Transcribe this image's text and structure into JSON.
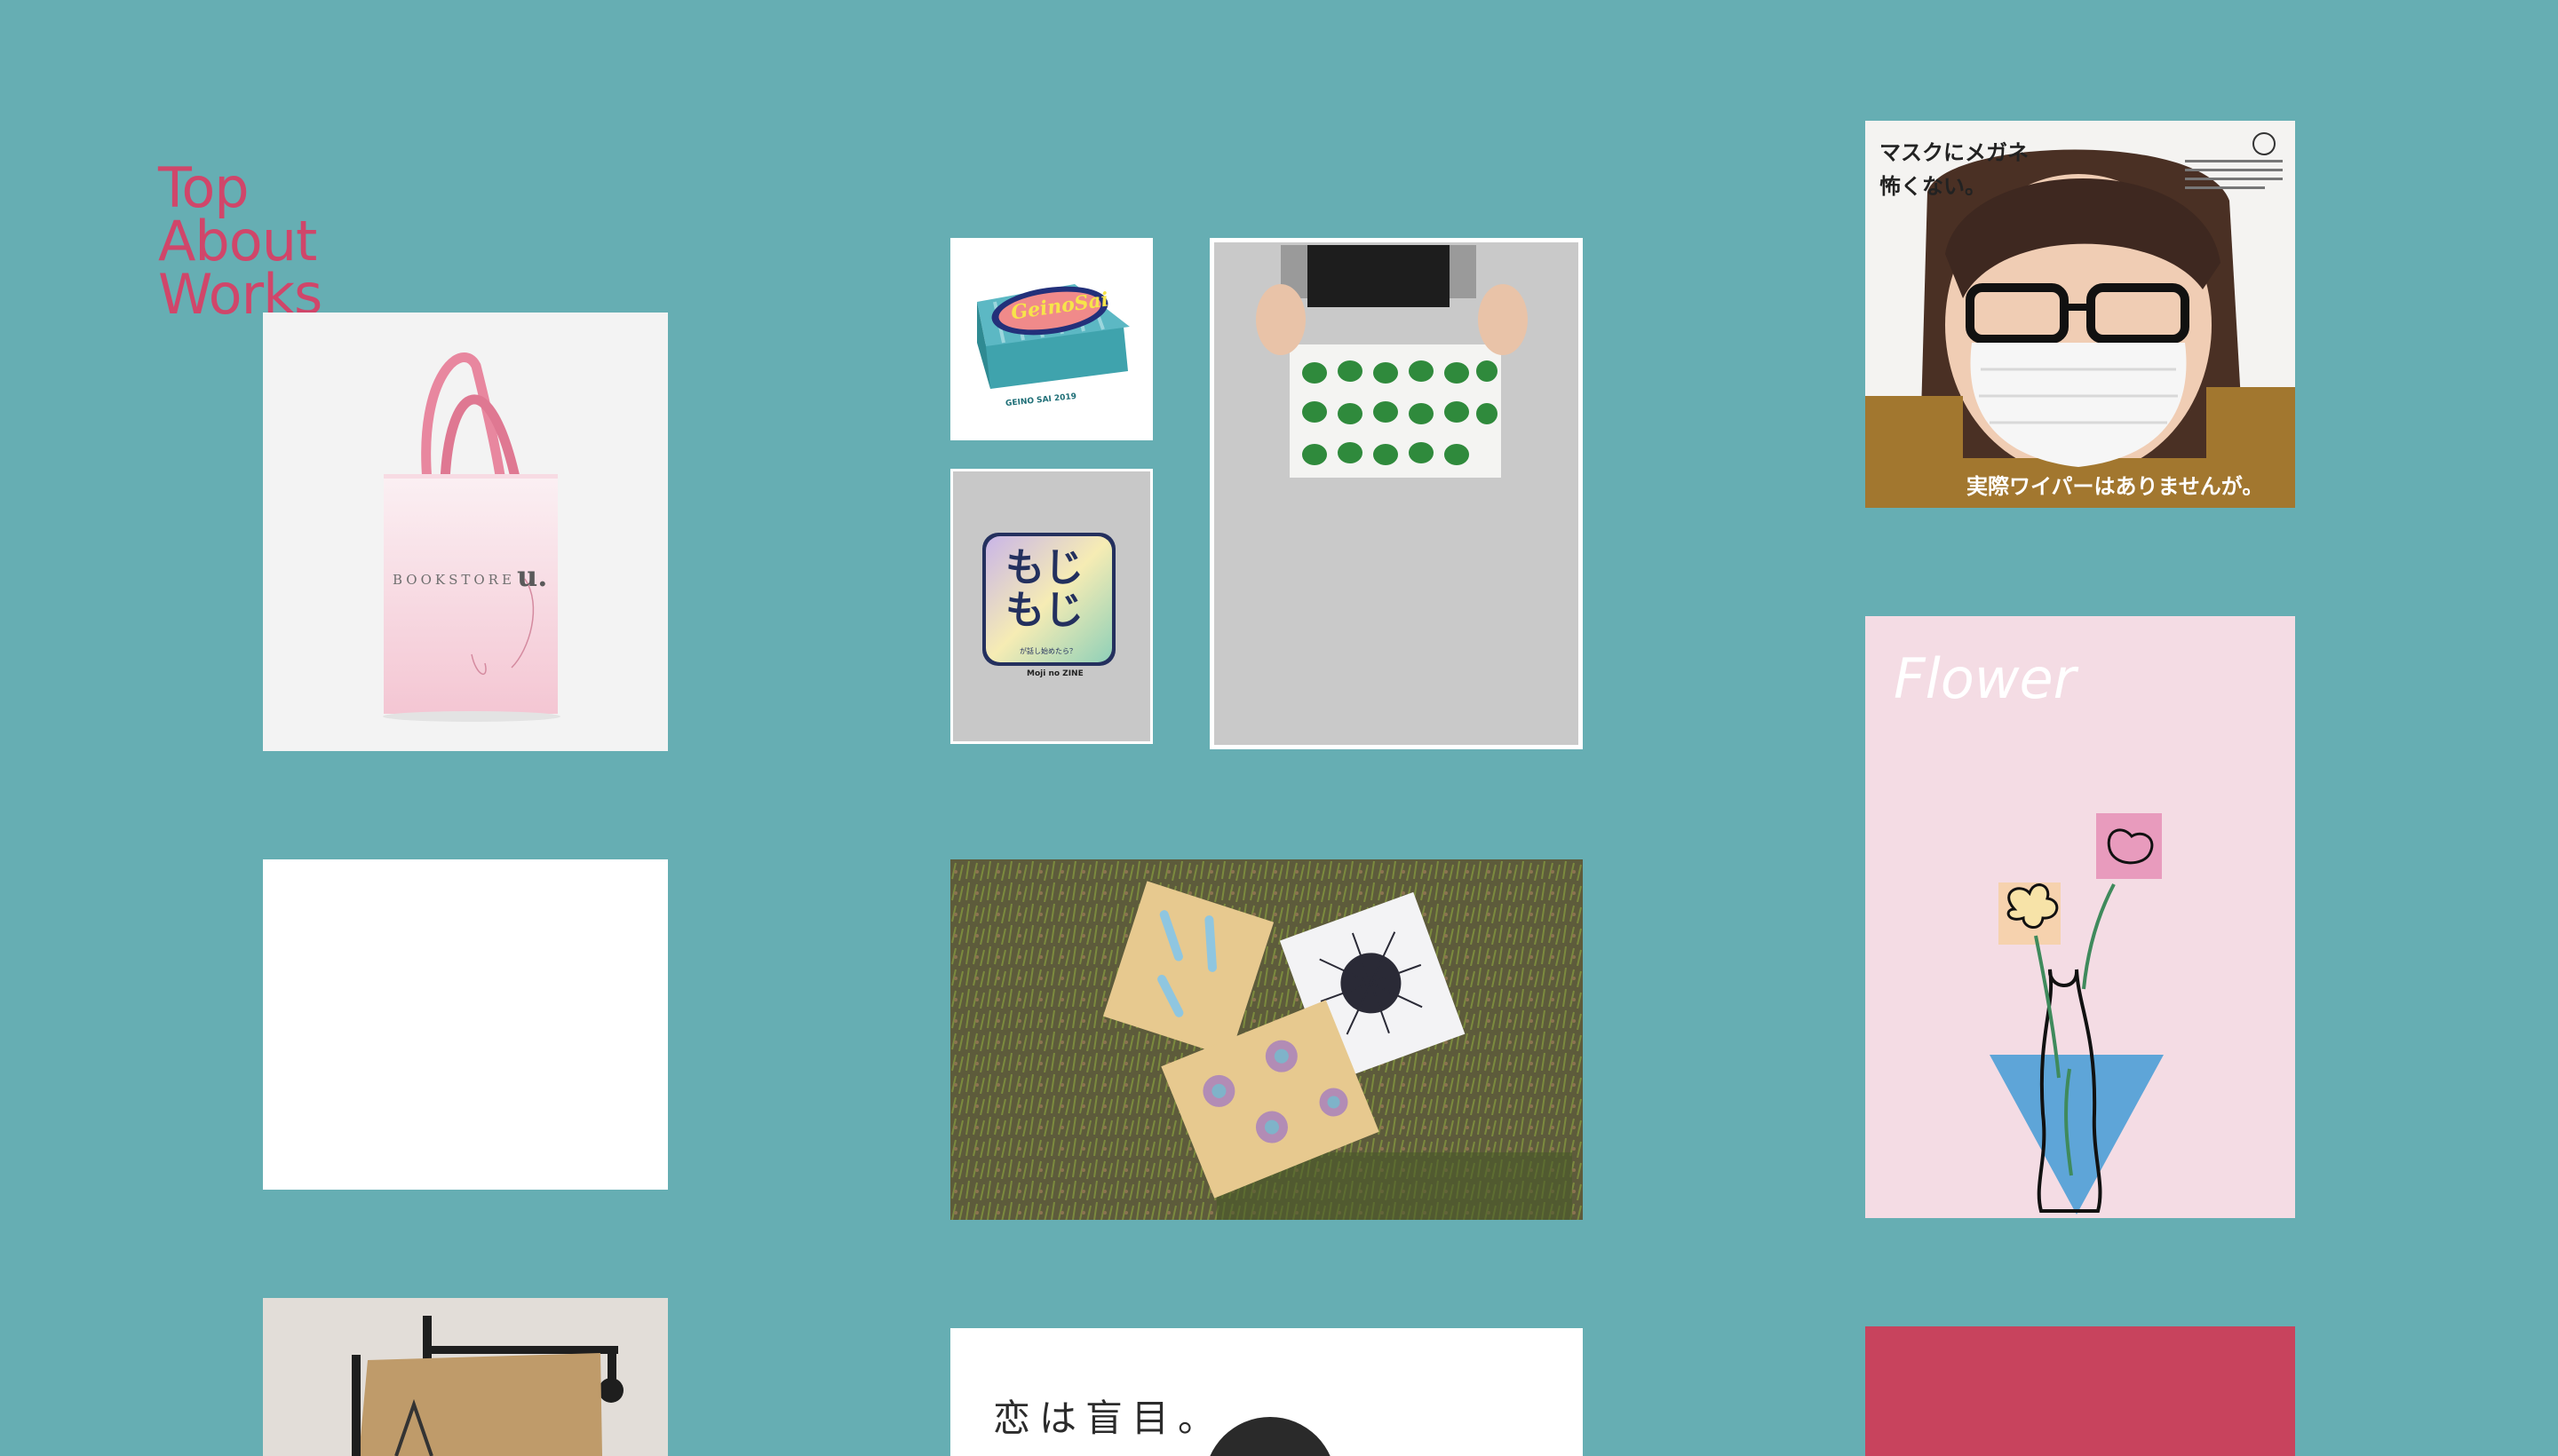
{
  "nav": {
    "items": [
      "Top",
      "About",
      "Works"
    ]
  },
  "works": {
    "bookstore": {
      "brand": "BOOKSTORE",
      "mark": "u."
    },
    "geino": {
      "logo": "GeinoSai",
      "sub": "GEINO SAI 2019"
    },
    "moji": {
      "title": "もじもじ",
      "caption": "が話し始めたら？",
      "subtitle": "Moji no ZINE"
    },
    "mask": {
      "headline_1": "マスクにメガネ",
      "headline_2": "怖くない。",
      "tagline": "実際ワイパーはありませんが。"
    },
    "flower": {
      "title": "Flower"
    },
    "koi": {
      "headline": "恋は盲目。"
    }
  },
  "colors": {
    "background": "#66aeb3",
    "nav_text": "#d0466a",
    "flower_bg": "#f4dce4",
    "red_tile": "#c8435d"
  }
}
